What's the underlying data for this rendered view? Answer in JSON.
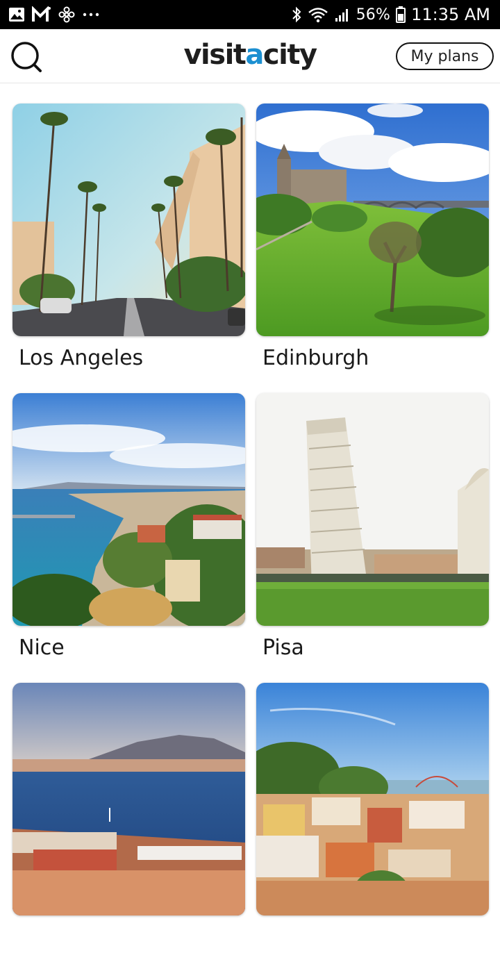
{
  "status_bar": {
    "left_icons": [
      "gallery-icon",
      "gmail-icon",
      "fan-icon",
      "more-dots-icon"
    ],
    "battery_percent": "56%",
    "time": "11:35 AM"
  },
  "header": {
    "logo_pre": "visit",
    "logo_accent": "a",
    "logo_post": "city",
    "accent_color": "#1b8fd1",
    "my_plans_label": "My plans"
  },
  "cities": [
    {
      "name": "Los Angeles"
    },
    {
      "name": "Edinburgh"
    },
    {
      "name": "Nice"
    },
    {
      "name": "Pisa"
    },
    {
      "name": ""
    },
    {
      "name": ""
    }
  ]
}
